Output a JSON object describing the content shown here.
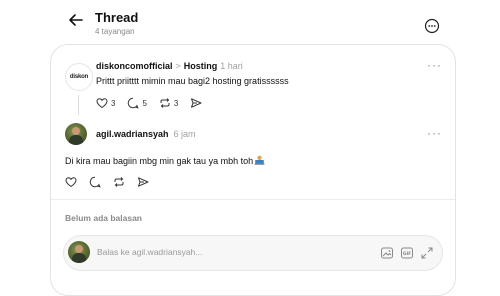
{
  "header": {
    "title": "Thread",
    "views": "4 tayangan"
  },
  "original_post": {
    "avatar_logo_text": "diskon",
    "username": "diskoncomofficial",
    "separator": ">",
    "topic": "Hosting",
    "time": "1 hari",
    "text": "Prittt priitttt mimin mau bagi2 hosting gratissssss",
    "likes": "3",
    "comments": "5",
    "reposts": "3"
  },
  "reply_post": {
    "username": "agil.wadriansyah",
    "time": "6 jam",
    "text": "Di kira mau bagiin mbg min gak tau ya mbh toh"
  },
  "replies": {
    "empty_label": "Belum ada balasan"
  },
  "reply_input": {
    "placeholder": "Balas ke agil.wadriansyah..."
  },
  "icons": {
    "back": "arrow-left-icon",
    "more": "more-circle-icon",
    "like": "heart-icon",
    "comment": "comment-icon",
    "repost": "repost-icon",
    "share": "send-icon",
    "image": "image-icon",
    "gif": "gif-icon",
    "expand": "expand-icon"
  }
}
